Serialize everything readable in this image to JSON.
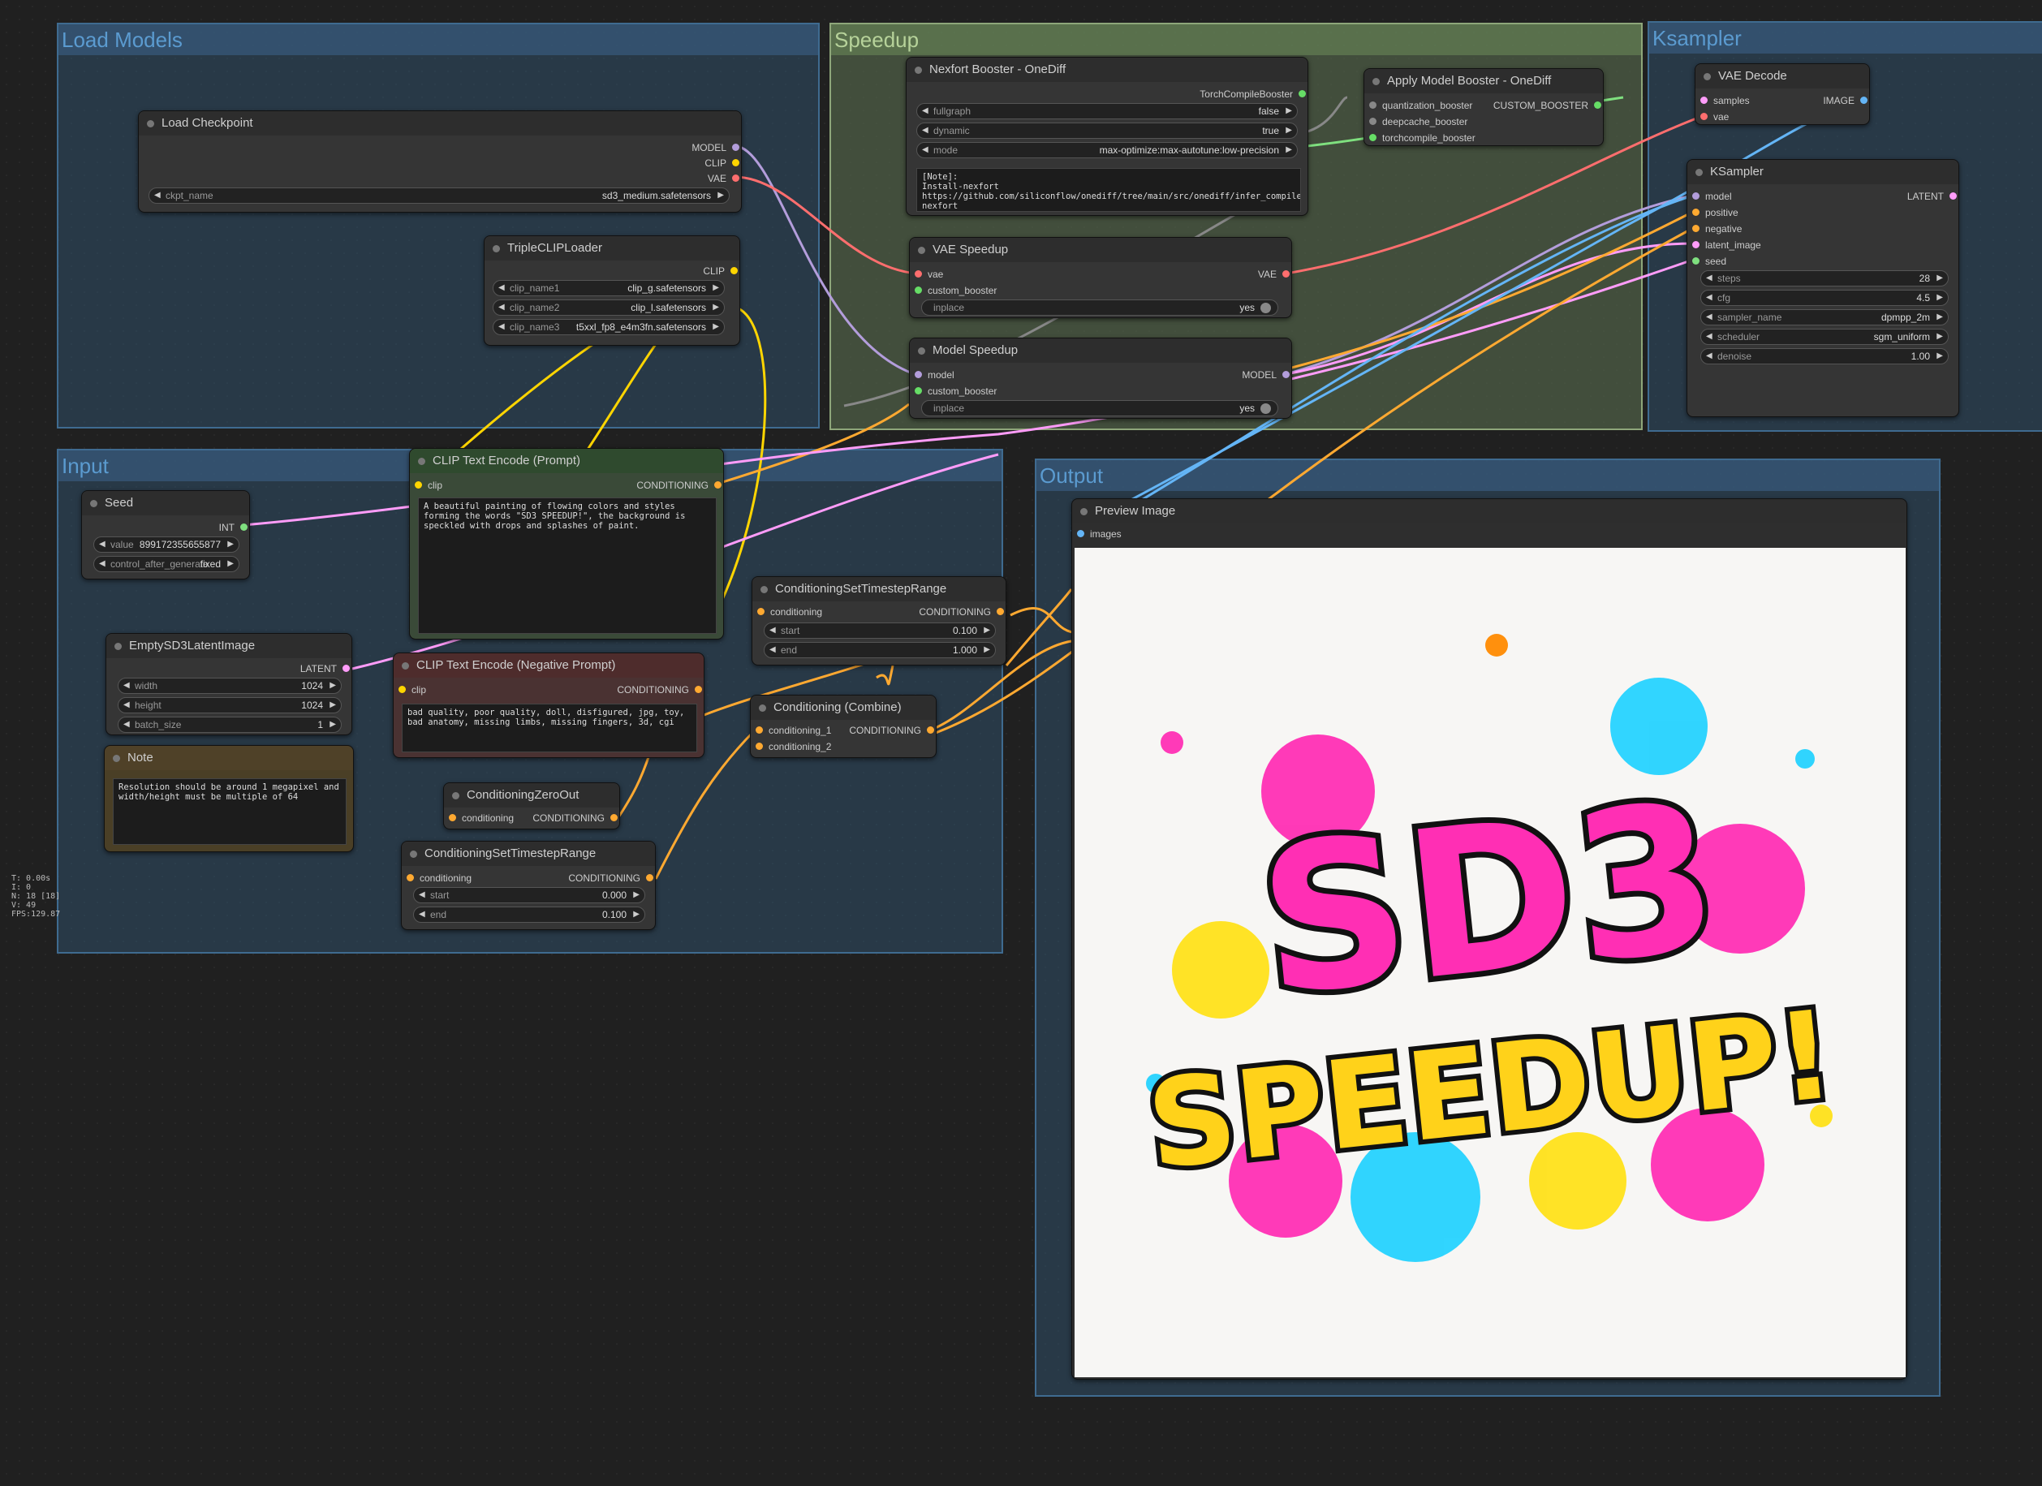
{
  "groups": {
    "load_models": "Load Models",
    "speedup": "Speedup",
    "ksampler": "Ksampler",
    "input": "Input",
    "output": "Output"
  },
  "nodes": {
    "load_checkpoint": {
      "title": "Load Checkpoint",
      "outputs": [
        "MODEL",
        "CLIP",
        "VAE"
      ],
      "ckpt_label": "ckpt_name",
      "ckpt_value": "sd3_medium.safetensors"
    },
    "triple_clip": {
      "title": "TripleCLIPLoader",
      "output": "CLIP",
      "widgets": [
        {
          "label": "clip_name1",
          "value": "clip_g.safetensors"
        },
        {
          "label": "clip_name2",
          "value": "clip_l.safetensors"
        },
        {
          "label": "clip_name3",
          "value": "t5xxl_fp8_e4m3fn.safetensors"
        }
      ]
    },
    "nexfort": {
      "title": "Nexfort Booster - OneDiff",
      "output": "TorchCompileBooster",
      "widgets": [
        {
          "label": "fullgraph",
          "value": "false"
        },
        {
          "label": "dynamic",
          "value": "true"
        },
        {
          "label": "mode",
          "value": "max-optimize:max-autotune:low-precision"
        }
      ],
      "note": "[Note]:\nInstall-nexfort\nhttps://github.com/siliconflow/onediff/tree/main/src/onediff/infer_compiler/backends/nexfort#install-nexfort"
    },
    "apply_booster": {
      "title": "Apply Model Booster - OneDiff",
      "inputs": [
        "quantization_booster",
        "deepcache_booster",
        "torchcompile_booster"
      ],
      "output": "CUSTOM_BOOSTER"
    },
    "vae_speedup": {
      "title": "VAE Speedup",
      "inputs": [
        "vae",
        "custom_booster"
      ],
      "output": "VAE",
      "inplace_label": "inplace",
      "inplace_value": "yes"
    },
    "model_speedup": {
      "title": "Model Speedup",
      "inputs": [
        "model",
        "custom_booster"
      ],
      "output": "MODEL",
      "inplace_label": "inplace",
      "inplace_value": "yes"
    },
    "vae_decode": {
      "title": "VAE Decode",
      "inputs": [
        "samples",
        "vae"
      ],
      "output": "IMAGE"
    },
    "ksampler": {
      "title": "KSampler",
      "inputs": [
        "model",
        "positive",
        "negative",
        "latent_image",
        "seed"
      ],
      "output": "LATENT",
      "widgets": [
        {
          "label": "steps",
          "value": "28"
        },
        {
          "label": "cfg",
          "value": "4.5"
        },
        {
          "label": "sampler_name",
          "value": "dpmpp_2m"
        },
        {
          "label": "scheduler",
          "value": "sgm_uniform"
        },
        {
          "label": "denoise",
          "value": "1.00"
        }
      ]
    },
    "seed": {
      "title": "Seed",
      "output": "INT",
      "widgets": [
        {
          "label": "value",
          "value": "899172355655877"
        },
        {
          "label": "control_after_generate",
          "value": "fixed"
        }
      ]
    },
    "clip_pos": {
      "title": "CLIP Text Encode (Prompt)",
      "input": "clip",
      "output": "CONDITIONING",
      "text": "A beautiful painting of flowing colors and styles forming the words \"SD3 SPEEDUP!\", the background is speckled with drops and splashes of paint."
    },
    "empty_latent": {
      "title": "EmptySD3LatentImage",
      "output": "LATENT",
      "widgets": [
        {
          "label": "width",
          "value": "1024"
        },
        {
          "label": "height",
          "value": "1024"
        },
        {
          "label": "batch_size",
          "value": "1"
        }
      ]
    },
    "clip_neg": {
      "title": "CLIP Text Encode (Negative Prompt)",
      "input": "clip",
      "output": "CONDITIONING",
      "text": "bad quality, poor quality, doll, disfigured, jpg, toy, bad anatomy, missing limbs, missing fingers, 3d, cgi"
    },
    "note": {
      "title": "Note",
      "text": "Resolution should be around 1 megapixel and width/height must be multiple of 64"
    },
    "cond_zero": {
      "title": "ConditioningZeroOut",
      "input": "conditioning",
      "output": "CONDITIONING"
    },
    "cond_range1": {
      "title": "ConditioningSetTimestepRange",
      "input": "conditioning",
      "output": "CONDITIONING",
      "widgets": [
        {
          "label": "start",
          "value": "0.100"
        },
        {
          "label": "end",
          "value": "1.000"
        }
      ]
    },
    "cond_combine": {
      "title": "Conditioning (Combine)",
      "inputs": [
        "conditioning_1",
        "conditioning_2"
      ],
      "output": "CONDITIONING"
    },
    "cond_range2": {
      "title": "ConditioningSetTimestepRange",
      "input": "conditioning",
      "output": "CONDITIONING",
      "widgets": [
        {
          "label": "start",
          "value": "0.000"
        },
        {
          "label": "end",
          "value": "0.100"
        }
      ]
    },
    "preview": {
      "title": "Preview Image",
      "input": "images",
      "image_text_top": "SD3",
      "image_text_bottom": "SPEEDUP!"
    }
  },
  "stats": [
    "T: 0.00s",
    "I: 0",
    "N: 18 [18]",
    "V: 49",
    "FPS:129.87"
  ],
  "colors": {
    "model": "#b39ddb",
    "clip": "#ffd500",
    "vae": "#ff6e6e",
    "conditioning": "#ffa931",
    "latent": "#ff9cf9",
    "int": "#7fe07f",
    "image": "#64b5f6",
    "booster": "#66dd66"
  }
}
